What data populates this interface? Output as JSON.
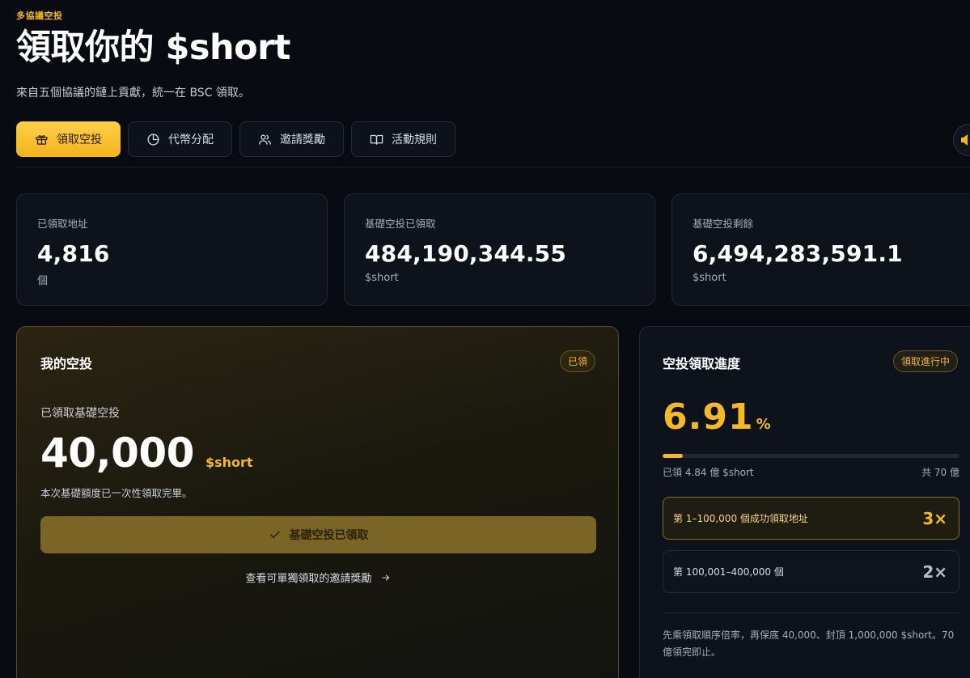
{
  "header": {
    "eyebrow": "多協議空投",
    "title": "領取你的 $short",
    "subtitle": "來自五個協議的鏈上貢獻，統一在 BSC 領取。"
  },
  "tabs": [
    {
      "label": "領取空投",
      "icon": "gift-icon",
      "active": true
    },
    {
      "label": "代幣分配",
      "icon": "pie-chart-icon",
      "active": false
    },
    {
      "label": "邀請獎勵",
      "icon": "users-icon",
      "active": false
    },
    {
      "label": "活動規則",
      "icon": "book-icon",
      "active": false
    }
  ],
  "stats": [
    {
      "label": "已領取地址",
      "value": "4,816",
      "unit": "個"
    },
    {
      "label": "基礎空投已領取",
      "value": "484,190,344.55",
      "unit": "$short"
    },
    {
      "label": "基礎空投剩餘",
      "value": "6,494,283,591.1",
      "unit": "$short"
    }
  ],
  "my_airdrop": {
    "title": "我的空投",
    "badge": "已領",
    "label": "已領取基礎空投",
    "amount": "40,000",
    "currency": "$short",
    "note": "本次基礎額度已一次性領取完畢。",
    "button_label": "基礎空投已領取",
    "invite_link": "查看可單獨領取的邀請獎勵"
  },
  "progress": {
    "title": "空投領取進度",
    "badge": "領取進行中",
    "percent": "6.91",
    "percent_sign": "%",
    "fraction": 0.0691,
    "claimed_text": "已領 4.84 億 $short",
    "total_text": "共 70 億",
    "tiers": [
      {
        "text": "第 1–100,000 個成功領取地址",
        "multiplier": "3×",
        "highlight": true
      },
      {
        "text": "第 100,001–400,000 個",
        "multiplier": "2×",
        "highlight": false
      }
    ],
    "footnote": "先乘領取順序倍率，再保底 40,000、封頂 1,000,000 $short。70 億領完即止。"
  },
  "colors": {
    "accent": "#f5b829",
    "background": "#080b12",
    "card": "#0e121a"
  }
}
